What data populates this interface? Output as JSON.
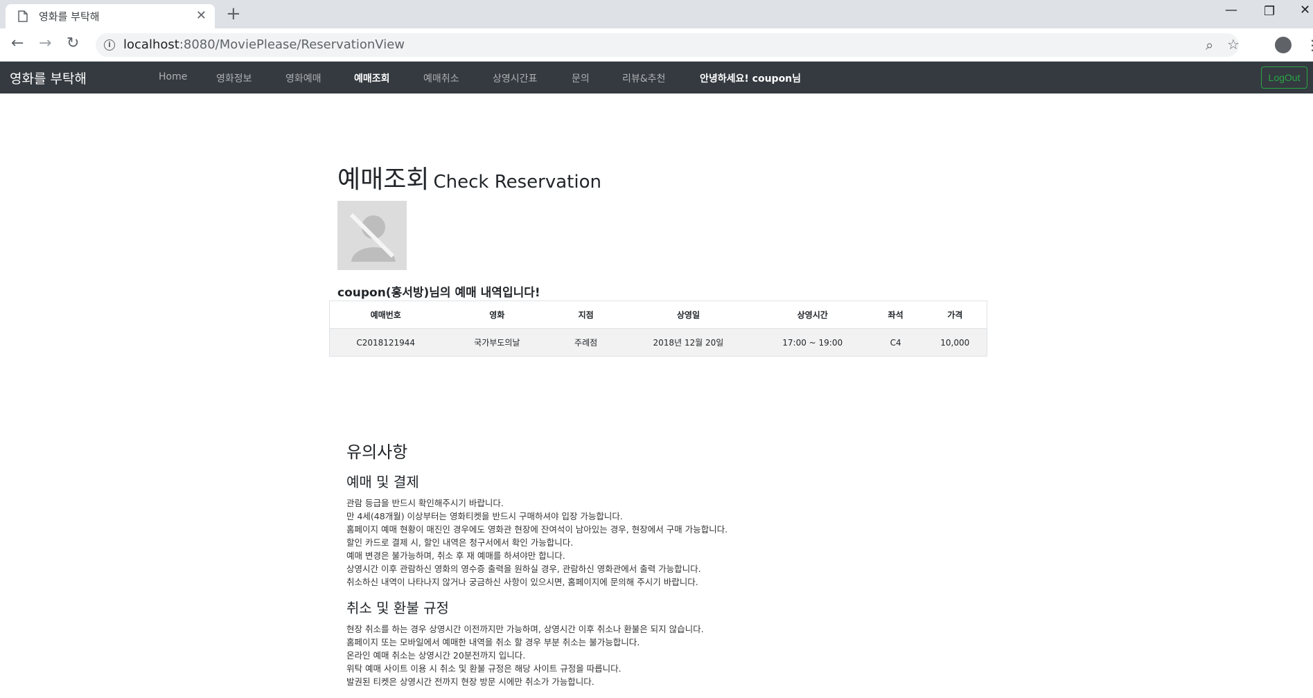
{
  "browser": {
    "tab_title": "영화를 부탁해",
    "url_host": "localhost",
    "url_path": ":8080/MoviePlease/ReservationView"
  },
  "navbar": {
    "brand": "영화를 부탁해",
    "items": [
      {
        "label": "Home",
        "active": false
      },
      {
        "label": "영화정보",
        "active": false
      },
      {
        "label": "영화예매",
        "active": false
      },
      {
        "label": "예매조회",
        "active": true
      },
      {
        "label": "예매취소",
        "active": false
      },
      {
        "label": "상영시간표",
        "active": false
      },
      {
        "label": "문의",
        "active": false
      },
      {
        "label": "리뷰&추천",
        "active": false
      }
    ],
    "greeting": "안녕하세요! coupon님",
    "logout": "LogOut",
    "colors": {
      "bg": "#343a40",
      "logout": "#28a745"
    }
  },
  "main": {
    "title_ko": "예매조회",
    "title_en": "Check Reservation",
    "subtitle": "coupon(홍서방)님의 예매 내역입니다!",
    "table": {
      "headers": [
        "예매번호",
        "영화",
        "지점",
        "상영일",
        "상영시간",
        "좌석",
        "가격"
      ],
      "rows": [
        [
          "C2018121944",
          "국가부도의날",
          "주례점",
          "2018년 12월 20일",
          "17:00 ~ 19:00",
          "C4",
          "10,000"
        ]
      ]
    }
  },
  "notice": {
    "title": "유의사항",
    "sections": [
      {
        "heading": "예매 및 결제",
        "lines": [
          "관람 등급을 반드시 확인해주시기 바랍니다.",
          "만 4세(48개월) 이상부터는 영화티켓을 반드시 구매하셔야 입장 가능합니다.",
          "홈페이지 예매 현황이 매진인 경우에도 영화관 현장에 잔여석이 남아있는 경우, 현장에서 구매 가능합니다.",
          "할인 카드로 결제 시, 할인 내역은 청구서에서 확인 가능합니다.",
          "예매 변경은 불가능하며, 취소 후 재 예매를 하셔야만 합니다.",
          "상영시간 이후 관람하신 영화의 영수증 출력을 원하실 경우, 관람하신 영화관에서 출력 가능합니다.",
          "취소하신 내역이 나타나지 않거나 궁금하신 사항이 있으시면, 홈페이지에 문의해 주시기 바랍니다."
        ]
      },
      {
        "heading": "취소 및 환불 규정",
        "lines": [
          "현장 취소를 하는 경우 상영시간 이전까지만 가능하며, 상영시간 이후 취소나 환불은 되지 않습니다.",
          "홈페이지 또는 모바일에서 예매한 내역을 취소 할 경우 부분 취소는 불가능합니다.",
          "온라인 예매 취소는 상영시간 20분전까지 입니다.",
          "위탁 예매 사이트 이용 시 취소 및 환불 규정은 해당 사이트 규정을 따릅니다.",
          "발권된 티켓은 상영시간 전까지 현장 방문 시에만 취소가 가능합니다."
        ]
      }
    ]
  }
}
